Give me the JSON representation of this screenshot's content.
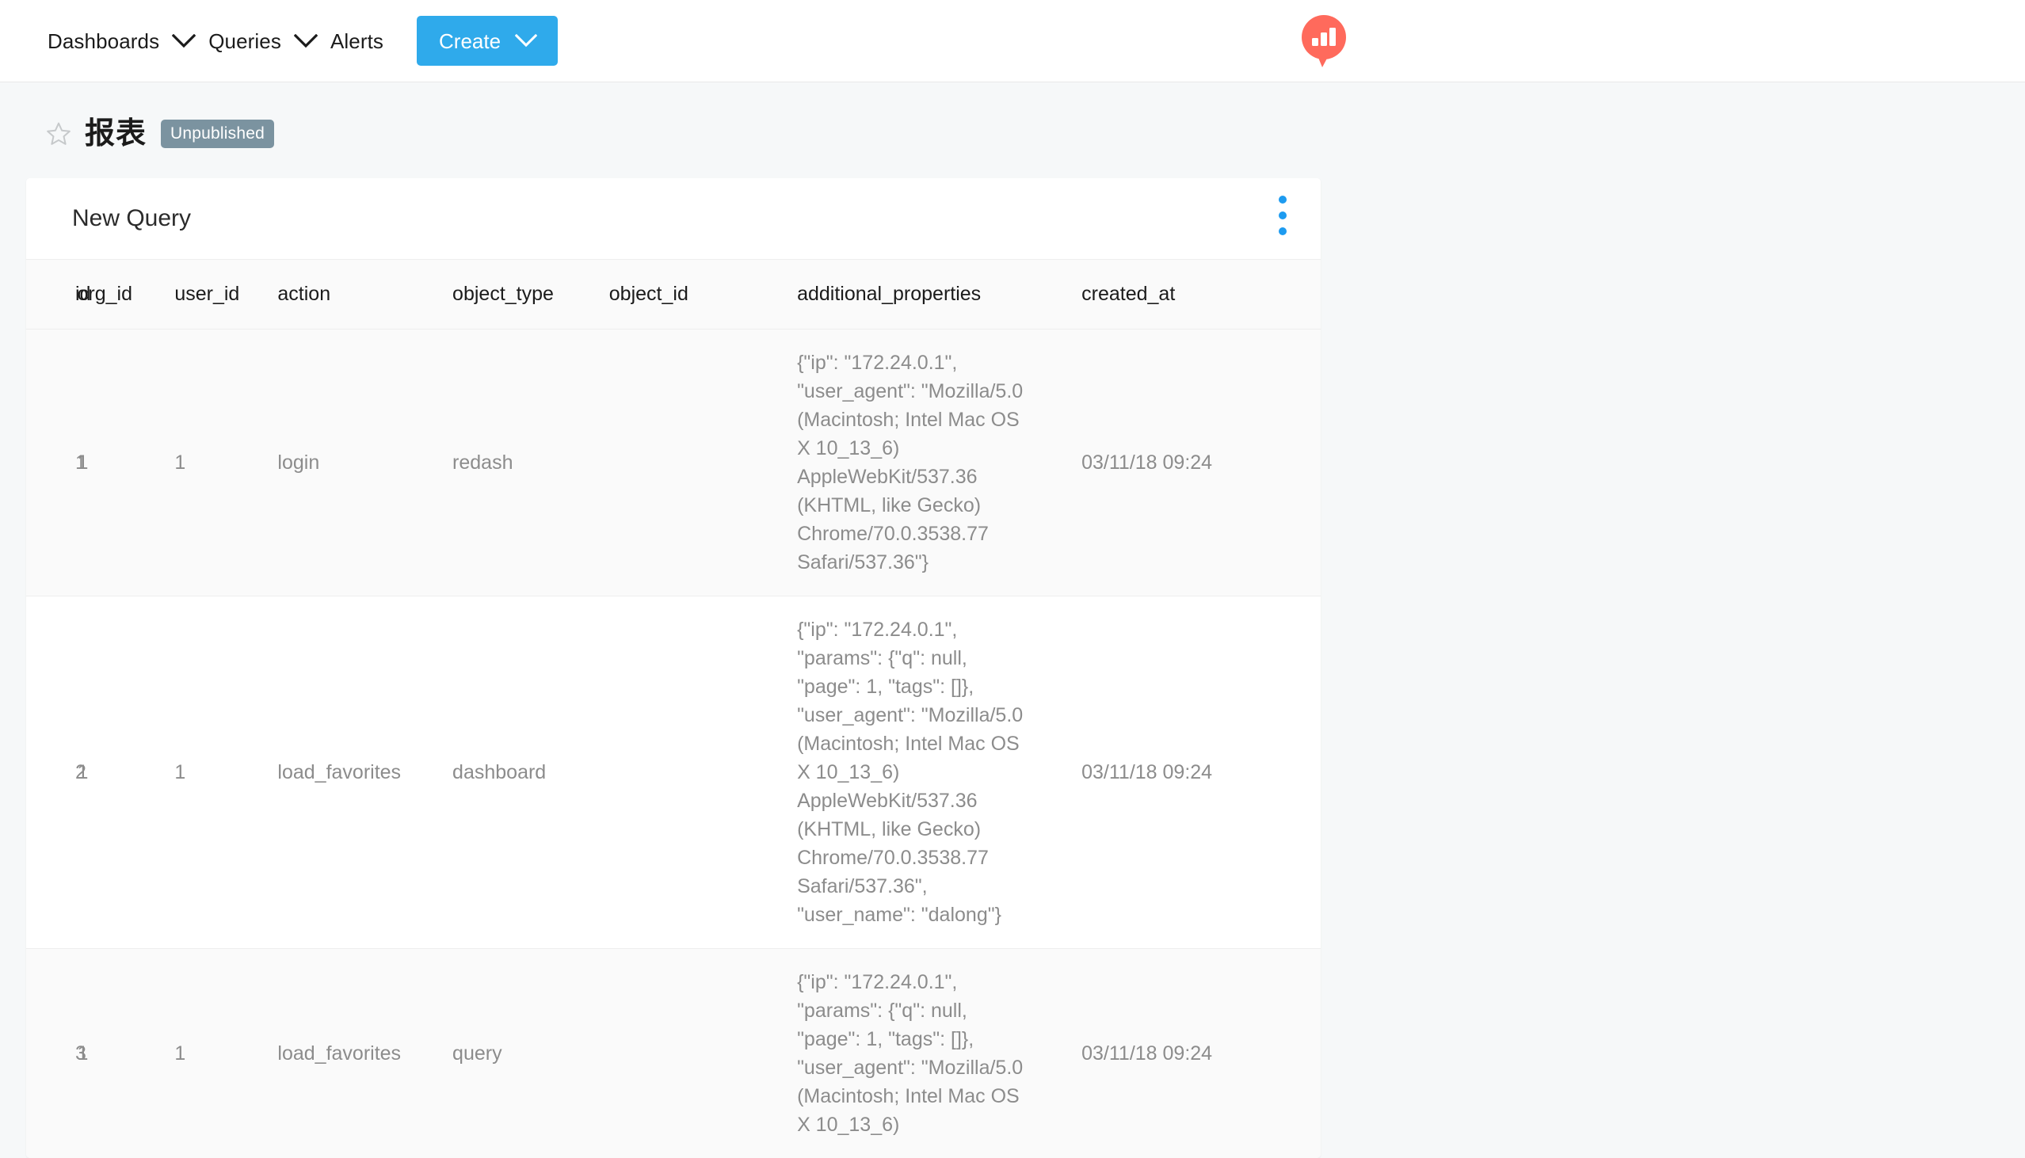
{
  "navbar": {
    "items": [
      {
        "label": "Dashboards",
        "has_caret": true
      },
      {
        "label": "Queries",
        "has_caret": true
      },
      {
        "label": "Alerts",
        "has_caret": false
      }
    ],
    "create_button": "Create",
    "logo_name": "redash-logo",
    "accent_color": "#2faaeb",
    "logo_color": "#ff6a5c"
  },
  "page": {
    "title": "报表",
    "status_badge": "Unpublished",
    "badge_color": "#7b93a0",
    "star_icon": "star-outline-icon"
  },
  "card": {
    "title": "New Query",
    "menu_icon": "kebab-menu-icon"
  },
  "table": {
    "columns": [
      "id",
      "org_id",
      "user_id",
      "action",
      "object_type",
      "object_id",
      "additional_properties",
      "created_at"
    ],
    "rows": [
      {
        "id": "1",
        "org_id": "1",
        "user_id": "1",
        "action": "login",
        "object_type": "redash",
        "object_id": "",
        "additional_properties": "{\"ip\": \"172.24.0.1\",\n\"user_agent\": \"Mozilla/5.0\n(Macintosh; Intel Mac OS\nX 10_13_6)\nAppleWebKit/537.36\n(KHTML, like Gecko)\nChrome/70.0.3538.77\nSafari/537.36\"}",
        "created_at": "03/11/18 09:24"
      },
      {
        "id": "2",
        "org_id": "1",
        "user_id": "1",
        "action": "load_favorites",
        "object_type": "dashboard",
        "object_id": "",
        "additional_properties": "{\"ip\": \"172.24.0.1\",\n\"params\": {\"q\": null,\n\"page\": 1, \"tags\": []},\n\"user_agent\": \"Mozilla/5.0\n(Macintosh; Intel Mac OS\nX 10_13_6)\nAppleWebKit/537.36\n(KHTML, like Gecko)\nChrome/70.0.3538.77\nSafari/537.36\",\n\"user_name\": \"dalong\"}",
        "created_at": "03/11/18 09:24"
      },
      {
        "id": "3",
        "org_id": "1",
        "user_id": "1",
        "action": "load_favorites",
        "object_type": "query",
        "object_id": "",
        "additional_properties": "{\"ip\": \"172.24.0.1\",\n\"params\": {\"q\": null,\n\"page\": 1, \"tags\": []},\n\"user_agent\": \"Mozilla/5.0\n(Macintosh; Intel Mac OS\nX 10_13_6)",
        "created_at": "03/11/18 09:24"
      }
    ]
  }
}
